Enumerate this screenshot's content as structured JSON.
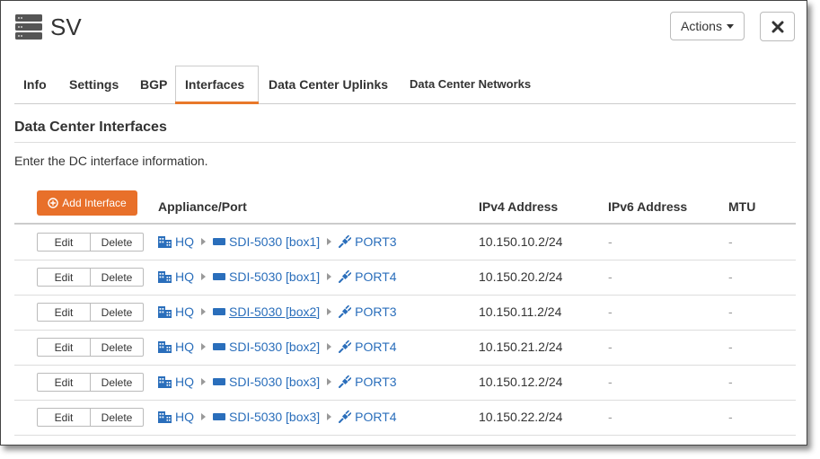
{
  "header": {
    "title": "SV",
    "actions_label": "Actions"
  },
  "tabs": [
    {
      "label": "Info"
    },
    {
      "label": "Settings"
    },
    {
      "label": "BGP"
    },
    {
      "label": "Interfaces"
    },
    {
      "label": "Data Center Uplinks"
    },
    {
      "label": "Data Center Networks"
    }
  ],
  "active_tab": "Interfaces",
  "section": {
    "title": "Data Center Interfaces",
    "description": "Enter the DC interface information."
  },
  "add_button_label": "Add Interface",
  "columns": {
    "appliance_port": "Appliance/Port",
    "ipv4": "IPv4 Address",
    "ipv6": "IPv6 Address",
    "mtu": "MTU"
  },
  "row_buttons": {
    "edit": "Edit",
    "delete": "Delete"
  },
  "rows": [
    {
      "site": "HQ",
      "appliance": "SDI-5030 [box1]",
      "port": "PORT3",
      "ipv4": "10.150.10.2/24",
      "ipv6": "-",
      "mtu": "-"
    },
    {
      "site": "HQ",
      "appliance": "SDI-5030 [box1]",
      "port": "PORT4",
      "ipv4": "10.150.20.2/24",
      "ipv6": "-",
      "mtu": "-"
    },
    {
      "site": "HQ",
      "appliance": "SDI-5030 [box2]",
      "port": "PORT3",
      "ipv4": "10.150.11.2/24",
      "ipv6": "-",
      "mtu": "-"
    },
    {
      "site": "HQ",
      "appliance": "SDI-5030 [box2]",
      "port": "PORT4",
      "ipv4": "10.150.21.2/24",
      "ipv6": "-",
      "mtu": "-"
    },
    {
      "site": "HQ",
      "appliance": "SDI-5030 [box3]",
      "port": "PORT3",
      "ipv4": "10.150.12.2/24",
      "ipv6": "-",
      "mtu": "-"
    },
    {
      "site": "HQ",
      "appliance": "SDI-5030 [box3]",
      "port": "PORT4",
      "ipv4": "10.150.22.2/24",
      "ipv6": "-",
      "mtu": "-"
    }
  ],
  "colors": {
    "accent": "#e8702a",
    "link": "#2a6ebb"
  },
  "icons": {
    "header": "server-stack-icon",
    "site": "building-icon",
    "appliance": "appliance-icon",
    "port": "plug-icon",
    "add": "plus-circle-icon",
    "close": "close-icon"
  }
}
